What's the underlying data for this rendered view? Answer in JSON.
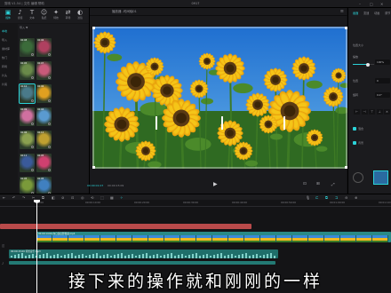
{
  "titlebar": {
    "app_title": "剪映 V1.54 | 文件 编辑 帮助",
    "center_title": "0917",
    "minimize": "–",
    "maximize": "□",
    "close": "✕"
  },
  "toolbar": {
    "items": [
      {
        "icon": "media-icon",
        "glyph": "▣",
        "label": "媒体",
        "active": true
      },
      {
        "icon": "audio-icon",
        "glyph": "♪",
        "label": "音频",
        "active": false
      },
      {
        "icon": "text-icon",
        "glyph": "T",
        "label": "文本",
        "active": false
      },
      {
        "icon": "sticker-icon",
        "glyph": "☺",
        "label": "贴纸",
        "active": false
      },
      {
        "icon": "effects-icon",
        "glyph": "✦",
        "label": "特效",
        "active": false
      },
      {
        "icon": "transition-icon",
        "glyph": "⇄",
        "label": "转场",
        "active": false
      },
      {
        "icon": "filter-icon",
        "glyph": "◐",
        "label": "滤镜",
        "active": false
      }
    ]
  },
  "library": {
    "sidebar": [
      "本地",
      "导入",
      "素材库",
      "热门",
      "转场",
      "片头",
      "片尾"
    ],
    "header": "导入  ▼",
    "thumbs": [
      {
        "dur": "00:08",
        "bg": "#3b6b3a"
      },
      {
        "dur": "00:06",
        "bg": "#b04060"
      },
      {
        "dur": "00:05",
        "bg": "#6a8a4a"
      },
      {
        "dur": "00:07",
        "bg": "#c85a7a"
      },
      {
        "dur": "00:10",
        "bg": "#4a7a8a"
      },
      {
        "dur": "00:06",
        "bg": "#e0a020"
      },
      {
        "dur": "00:09",
        "bg": "#d070a0"
      },
      {
        "dur": "00:04",
        "bg": "#5a9ad0"
      },
      {
        "dur": "00:06",
        "bg": "#8aa050"
      },
      {
        "dur": "00:12",
        "bg": "#c0a030"
      },
      {
        "dur": "00:11",
        "bg": "#3a5a9a"
      },
      {
        "dur": "00:05",
        "bg": "#d04070"
      },
      {
        "dur": "00:05",
        "bg": "#7a9a3a"
      },
      {
        "dur": "00:05",
        "bg": "#4080c0"
      }
    ]
  },
  "preview": {
    "title": "播放器 -时间轴01",
    "menu": "≡",
    "current_time": "00:00:01:07",
    "total_time": "00:00:15:09",
    "play": "▶",
    "icons": [
      "⊡",
      "⊞",
      "⤢"
    ]
  },
  "inspector": {
    "tabs": [
      "画面",
      "变速",
      "动画",
      "调节"
    ],
    "rows": [
      {
        "label": "位置大小",
        "value": ""
      },
      {
        "label": "缩放",
        "value": "100%"
      },
      {
        "label": "位置",
        "value": "0"
      },
      {
        "label": "旋转",
        "value": "0.0°"
      },
      {
        "label": "混合",
        "value": ""
      },
      {
        "label": "背景",
        "value": "无"
      }
    ],
    "align_glyphs": [
      "⊢",
      "⊣",
      "⊤",
      "⊥",
      "✕"
    ]
  },
  "timeline_toolbar": {
    "left_icons": [
      "⇤",
      "↶",
      "↷",
      "✂",
      "⧉",
      "◧",
      "⊘",
      "⊡",
      "◎",
      "⟲",
      "⬚",
      "▦",
      "✧"
    ],
    "right_icons": [
      "🎙",
      "⊏",
      "⧉",
      "⊐",
      "⊖",
      "⊕"
    ]
  },
  "timeline": {
    "ruler": [
      "00:00",
      "00:00:10:00",
      "00:00:20:00",
      "00:00:30:00",
      "00:00:40:00",
      "00:00:50:00",
      "00:01:00:00",
      "00:01:10:00"
    ],
    "video_clip_label": "00:00:14:09 向日葵田野视频.mp4",
    "audio_clip_label": "00:00:15:09 背景音乐.mp3",
    "track_heads": [
      "⊟",
      "◫",
      "♪"
    ]
  },
  "subtitle": "接下来的操作就和刚刚的一样",
  "colors": {
    "accent": "#2bd3d9",
    "clip_teal": "#2a8a86",
    "clip_red": "#b94a4a",
    "sky": "#2f86d6"
  }
}
